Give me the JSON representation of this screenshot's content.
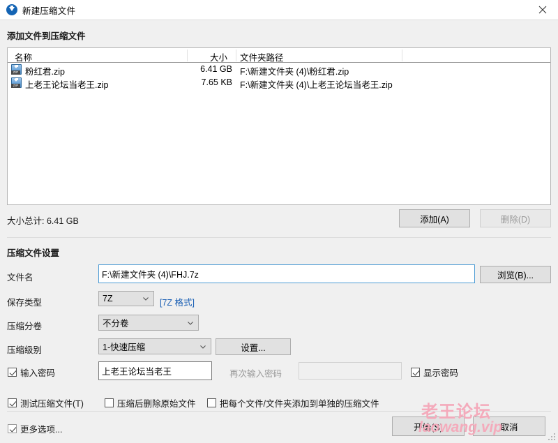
{
  "window": {
    "title": "新建压缩文件",
    "icon": "bandizip-icon",
    "close_label": "✕"
  },
  "add_section": {
    "heading": "添加文件到压缩文件",
    "columns": [
      "名称",
      "大小",
      "文件夹路径"
    ],
    "rows": [
      {
        "name": "粉红君.zip",
        "size": "6.41 GB",
        "path": "F:\\新建文件夹 (4)\\粉红君.zip",
        "icon": "zip-file-icon"
      },
      {
        "name": "上老王论坛当老王.zip",
        "size": "7.65 KB",
        "path": "F:\\新建文件夹 (4)\\上老王论坛当老王.zip",
        "icon": "zip-file-icon"
      }
    ],
    "total_label": "大小总计: 6.41 GB",
    "add_button": "添加(A)",
    "remove_button": "删除(D)",
    "remove_disabled": true
  },
  "settings_section": {
    "heading": "压缩文件设置",
    "filename_label": "文件名",
    "filename_value": "F:\\新建文件夹 (4)\\FHJ.7z",
    "browse_button": "浏览(B)...",
    "savetype_label": "保存类型",
    "savetype_value": "7Z",
    "format_link": "[7Z 格式]",
    "split_label": "压缩分卷",
    "split_value": "不分卷",
    "level_label": "压缩级别",
    "level_value": "1-快速压缩",
    "config_button": "设置...",
    "password_checkbox": "输入密码",
    "password_checked": true,
    "password_value": "上老王论坛当老王",
    "repeat_label": "再次输入密码",
    "repeat_value": "",
    "repeat_disabled": true,
    "showpw_checkbox": "显示密码",
    "showpw_checked": true,
    "test_checkbox": "测试压缩文件(T)",
    "test_checked": true,
    "delete_source_checkbox": "压缩后删除原始文件",
    "delete_source_checked": false,
    "separate_checkbox": "把每个文件/文件夹添加到单独的压缩文件",
    "separate_checked": false
  },
  "footer": {
    "more_options_checkbox": "更多选项...",
    "more_options_checked": true,
    "start_button": "开始(S)",
    "cancel_button": "取消"
  },
  "watermark": {
    "cn": "老王论坛",
    "en": "laowang.vip",
    "color": "#f4aabb"
  }
}
